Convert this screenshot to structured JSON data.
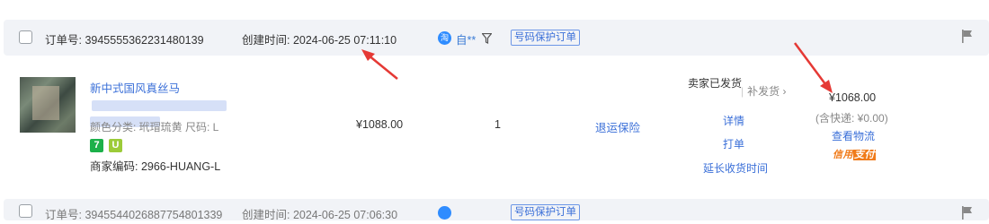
{
  "order": {
    "order_no_label": "订单号: 3945555362231480139",
    "created_label": "创建时间: 2024-06-25 07:11:10",
    "buyer_icon": "淘",
    "buyer_name": "自**",
    "protect_tag": "号码保护订单"
  },
  "product": {
    "title_line1": "新中式国风真丝马",
    "title_line2": "",
    "sku": "颜色分类: 玳瑁琉黄  尺码: L",
    "merchant_code": "商家编码: 2966-HUANG-L",
    "tag_a": "7",
    "tag_b": "U"
  },
  "columns": {
    "unit_price": "¥1088.00",
    "quantity": "1",
    "insurance": "退运保险"
  },
  "status": {
    "ship_status": "卖家已发货",
    "reissue": "补发货",
    "details": "详情",
    "print": "打单",
    "extend": "延长收货时间"
  },
  "payment": {
    "total": "¥1068.00",
    "shipping_note": "(含快递: ¥0.00)",
    "logistics": "查看物流",
    "credit_prefix": "信用",
    "credit_suffix": "支付"
  },
  "next_order": {
    "order_no_label": "订单号: 3945544026887754801339",
    "created_label": "创建时间: 2024-06-25 07:06:30",
    "protect_tag": "号码保护订单"
  },
  "colors": {
    "accent_blue": "#3a6fd8",
    "arrow_red": "#e53935",
    "credit_orange": "#f07b1a"
  }
}
